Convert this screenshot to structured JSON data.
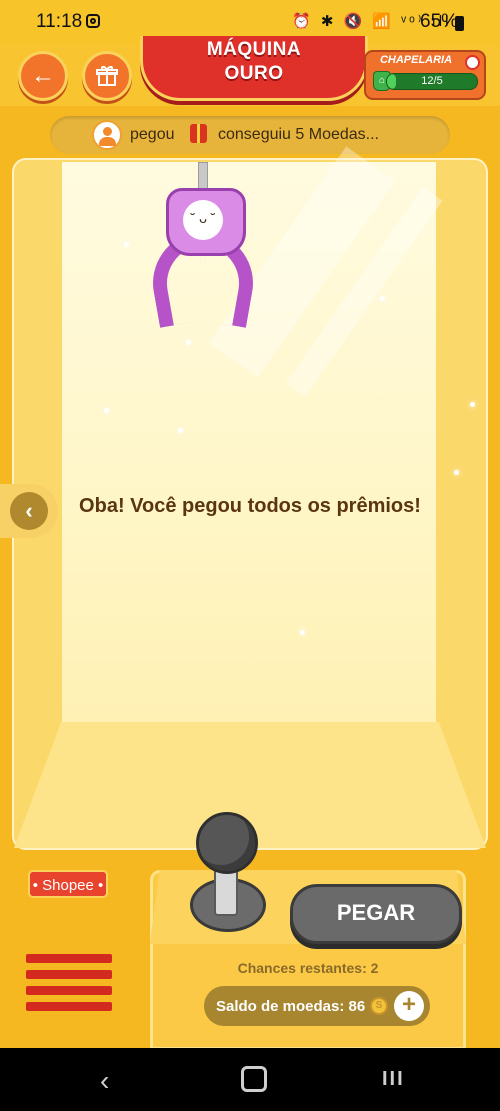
{
  "status": {
    "time": "11:18",
    "icons": "⏰ ✱ 🔇 📶 ᵛᵒ⁾ ıll",
    "battery": "65%"
  },
  "header": {
    "back_icon": "arrow-left-icon",
    "gift_icon": "gift-icon",
    "title_line1": "MÁQUINA",
    "title_line2": "OURO",
    "chapelaria": {
      "label": "CHAPELARIA",
      "progress_text": "12/5",
      "progress_fraction": 0.1
    }
  },
  "notice": {
    "user": "pegou",
    "message": "conseguiu 5 Moedas..."
  },
  "machine": {
    "message": "Oba! Você pegou todos os prêmios!"
  },
  "controls": {
    "shopee_label": "• Shopee •",
    "pegar_label": "PEGAR",
    "chances_text": "Chances restantes: 2",
    "saldo_text": "Saldo de moedas: 86",
    "plus_label": "+"
  },
  "navbar": {
    "back": "‹",
    "recent": "III"
  },
  "colors": {
    "background": "#f6b820",
    "banner_red": "#e0302a",
    "button_orange": "#f2732a",
    "pegar_gray": "#6a6a6a"
  }
}
